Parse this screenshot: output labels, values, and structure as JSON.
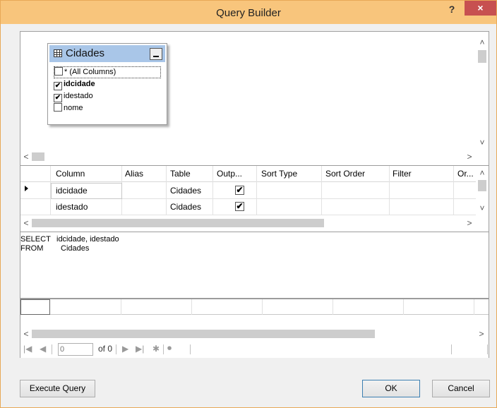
{
  "window": {
    "title": "Query Builder",
    "help": "?",
    "close": "×"
  },
  "diagram": {
    "table_name": "Cidades",
    "columns": [
      {
        "label": "* (All Columns)",
        "checked": false,
        "bold": false
      },
      {
        "label": "idcidade",
        "checked": true,
        "bold": true
      },
      {
        "label": "idestado",
        "checked": true,
        "bold": false
      },
      {
        "label": "nome",
        "checked": false,
        "bold": false
      }
    ]
  },
  "grid": {
    "headers": [
      "Column",
      "Alias",
      "Table",
      "Outp...",
      "Sort Type",
      "Sort Order",
      "Filter",
      "Or..."
    ],
    "rows": [
      {
        "column": "idcidade",
        "alias": "",
        "table": "Cidades",
        "output": "✔"
      },
      {
        "column": "idestado",
        "alias": "",
        "table": "Cidades",
        "output": "✔"
      }
    ]
  },
  "sql": {
    "line1_keyword": "SELECT",
    "line1_value": "idcidade, idestado",
    "line2_keyword": "FROM",
    "line2_value": "Cidades"
  },
  "navigator": {
    "position": "0",
    "of_label": "of 0"
  },
  "buttons": {
    "execute": "Execute Query",
    "ok": "OK",
    "cancel": "Cancel"
  },
  "colors": {
    "titlebar": "#f8c57c",
    "close": "#c75050",
    "table_header": "#a9c6e8"
  }
}
